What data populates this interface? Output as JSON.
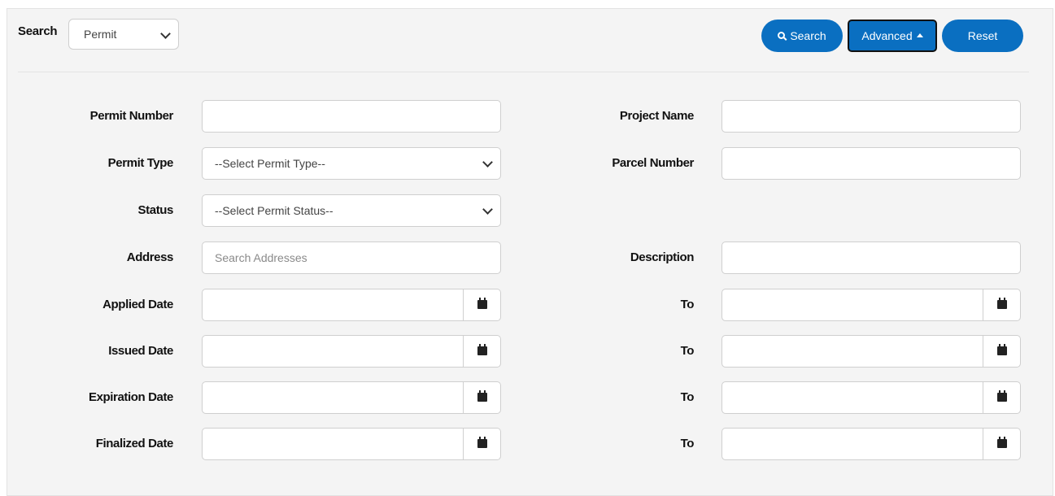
{
  "toolbar": {
    "search_label": "Search",
    "scope_value": "Permit",
    "search_button": "Search",
    "advanced_button": "Advanced",
    "reset_button": "Reset"
  },
  "form": {
    "permit_number_label": "Permit Number",
    "permit_number_value": "",
    "project_name_label": "Project Name",
    "project_name_value": "",
    "permit_type_label": "Permit Type",
    "permit_type_value": "--Select Permit Type--",
    "parcel_number_label": "Parcel Number",
    "parcel_number_value": "",
    "status_label": "Status",
    "status_value": "--Select Permit Status--",
    "address_label": "Address",
    "address_placeholder": "Search Addresses",
    "description_label": "Description",
    "description_value": "",
    "to_label": "To",
    "applied_date_label": "Applied Date",
    "issued_date_label": "Issued Date",
    "expiration_date_label": "Expiration Date",
    "finalized_date_label": "Finalized Date"
  },
  "colors": {
    "primary": "#0a6fc1",
    "panel_bg": "#f4f4f4",
    "border": "#cfcfcf"
  },
  "icons": [
    "search-icon",
    "caret-up-icon",
    "chevron-down-icon",
    "calendar-icon"
  ]
}
